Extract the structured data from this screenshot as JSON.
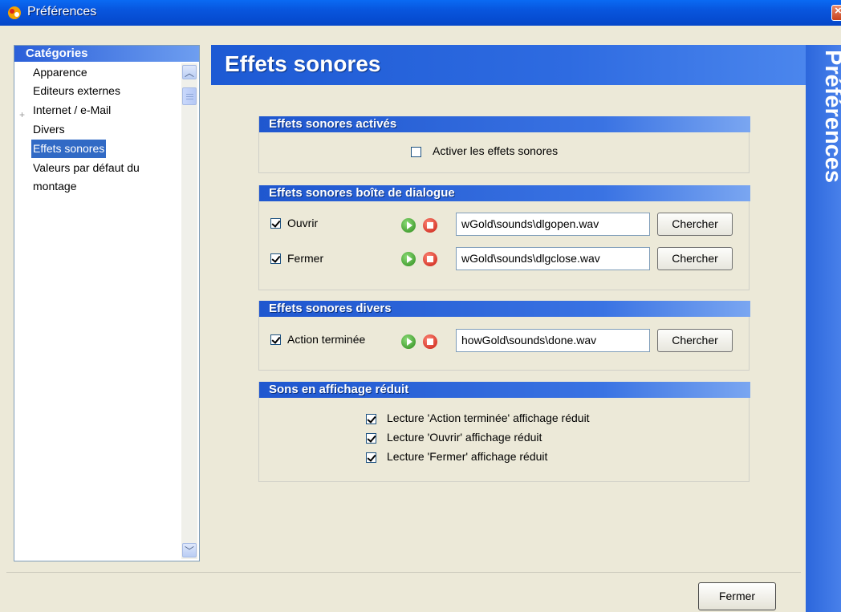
{
  "window": {
    "title": "Préférences"
  },
  "categories": {
    "header": "Catégories",
    "items": [
      {
        "label": "Apparence"
      },
      {
        "label": "Editeurs externes"
      },
      {
        "label": "Internet / e-Mail"
      },
      {
        "label": "Divers"
      },
      {
        "label": "Effets sonores"
      },
      {
        "label": "Valeurs par défaut du montage"
      }
    ],
    "selected": "Effets sonores"
  },
  "page": {
    "title": "Effets sonores",
    "side_banner": "Préférences"
  },
  "groups": {
    "enabled": {
      "header": "Effets sonores activés",
      "checkbox_label": "Activer les effets sonores",
      "checked": false
    },
    "dialog": {
      "header": "Effets sonores boîte de dialogue",
      "rows": [
        {
          "label": "Ouvrir",
          "checked": true,
          "path": "wGold\\sounds\\dlgopen.wav",
          "button": "Chercher"
        },
        {
          "label": "Fermer",
          "checked": true,
          "path": "wGold\\sounds\\dlgclose.wav",
          "button": "Chercher"
        }
      ]
    },
    "misc": {
      "header": "Effets sonores divers",
      "rows": [
        {
          "label": "Action terminée",
          "checked": true,
          "path": "howGold\\sounds\\done.wav",
          "button": "Chercher"
        }
      ]
    },
    "reduced": {
      "header": "Sons en affichage réduit",
      "options": [
        {
          "label": "Lecture 'Action terminée' affichage réduit",
          "checked": true
        },
        {
          "label": "Lecture 'Ouvrir' affichage réduit",
          "checked": true
        },
        {
          "label": "Lecture 'Fermer' affichage réduit",
          "checked": true
        }
      ]
    }
  },
  "footer": {
    "close_label": "Fermer"
  },
  "colors": {
    "accent": "#2e6be1",
    "selection": "#316ac5",
    "title_bar": "#0855dd"
  }
}
